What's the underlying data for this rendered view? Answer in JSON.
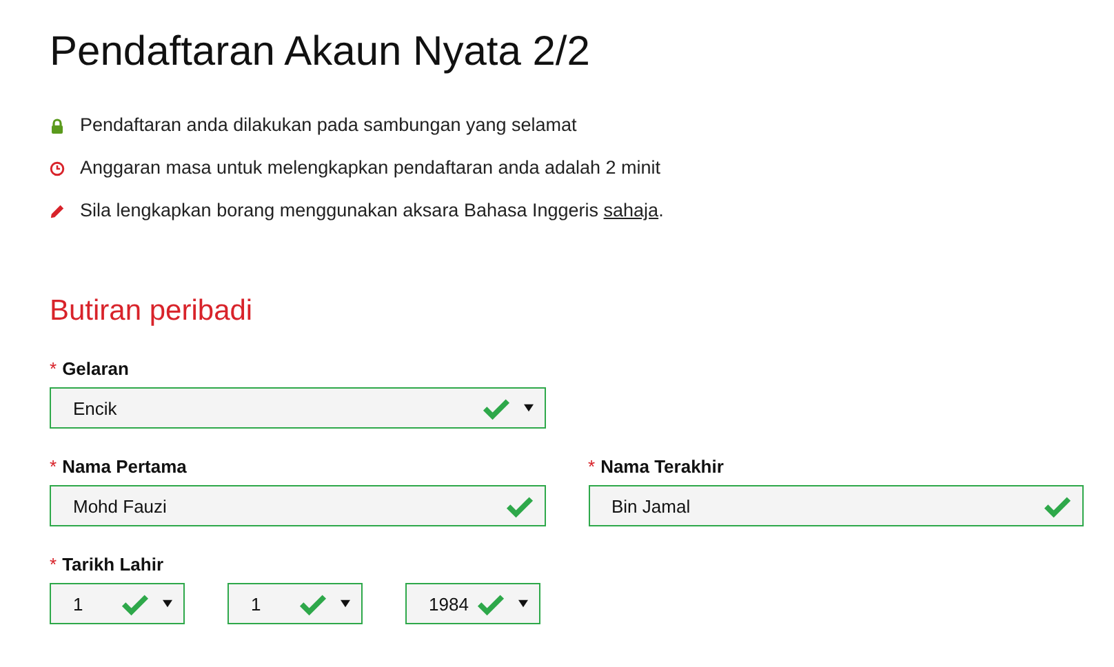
{
  "title": "Pendaftaran Akaun Nyata 2/2",
  "notices": [
    {
      "kind": "lock",
      "text": "Pendaftaran anda dilakukan pada sambungan yang selamat"
    },
    {
      "kind": "clock",
      "text": "Anggaran masa untuk melengkapkan pendaftaran anda adalah 2 minit"
    },
    {
      "kind": "pencil",
      "text": "Sila lengkapkan borang menggunakan aksara Bahasa Inggeris ",
      "link": "sahaja",
      "after": "."
    }
  ],
  "section": "Butiran peribadi",
  "rows": [
    {
      "fields": [
        {
          "kind": "select",
          "marker": "*",
          "label": "Gelaran",
          "value": "Encik",
          "valid": true
        }
      ]
    },
    {
      "fields": [
        {
          "kind": "text",
          "marker": "*",
          "label": "Nama Pertama",
          "value": "Mohd Fauzi",
          "valid": true
        },
        {
          "kind": "text",
          "marker": "*",
          "label": "Nama Terakhir",
          "value": "Bin Jamal",
          "valid": true
        }
      ]
    },
    {
      "fields": [
        {
          "kind": "date",
          "marker": "*",
          "label": "Tarikh Lahir",
          "parts": [
            {
              "value": "1",
              "valid": true
            },
            {
              "value": "1",
              "valid": true
            },
            {
              "value": "1984",
              "valid": true
            }
          ]
        }
      ]
    }
  ]
}
